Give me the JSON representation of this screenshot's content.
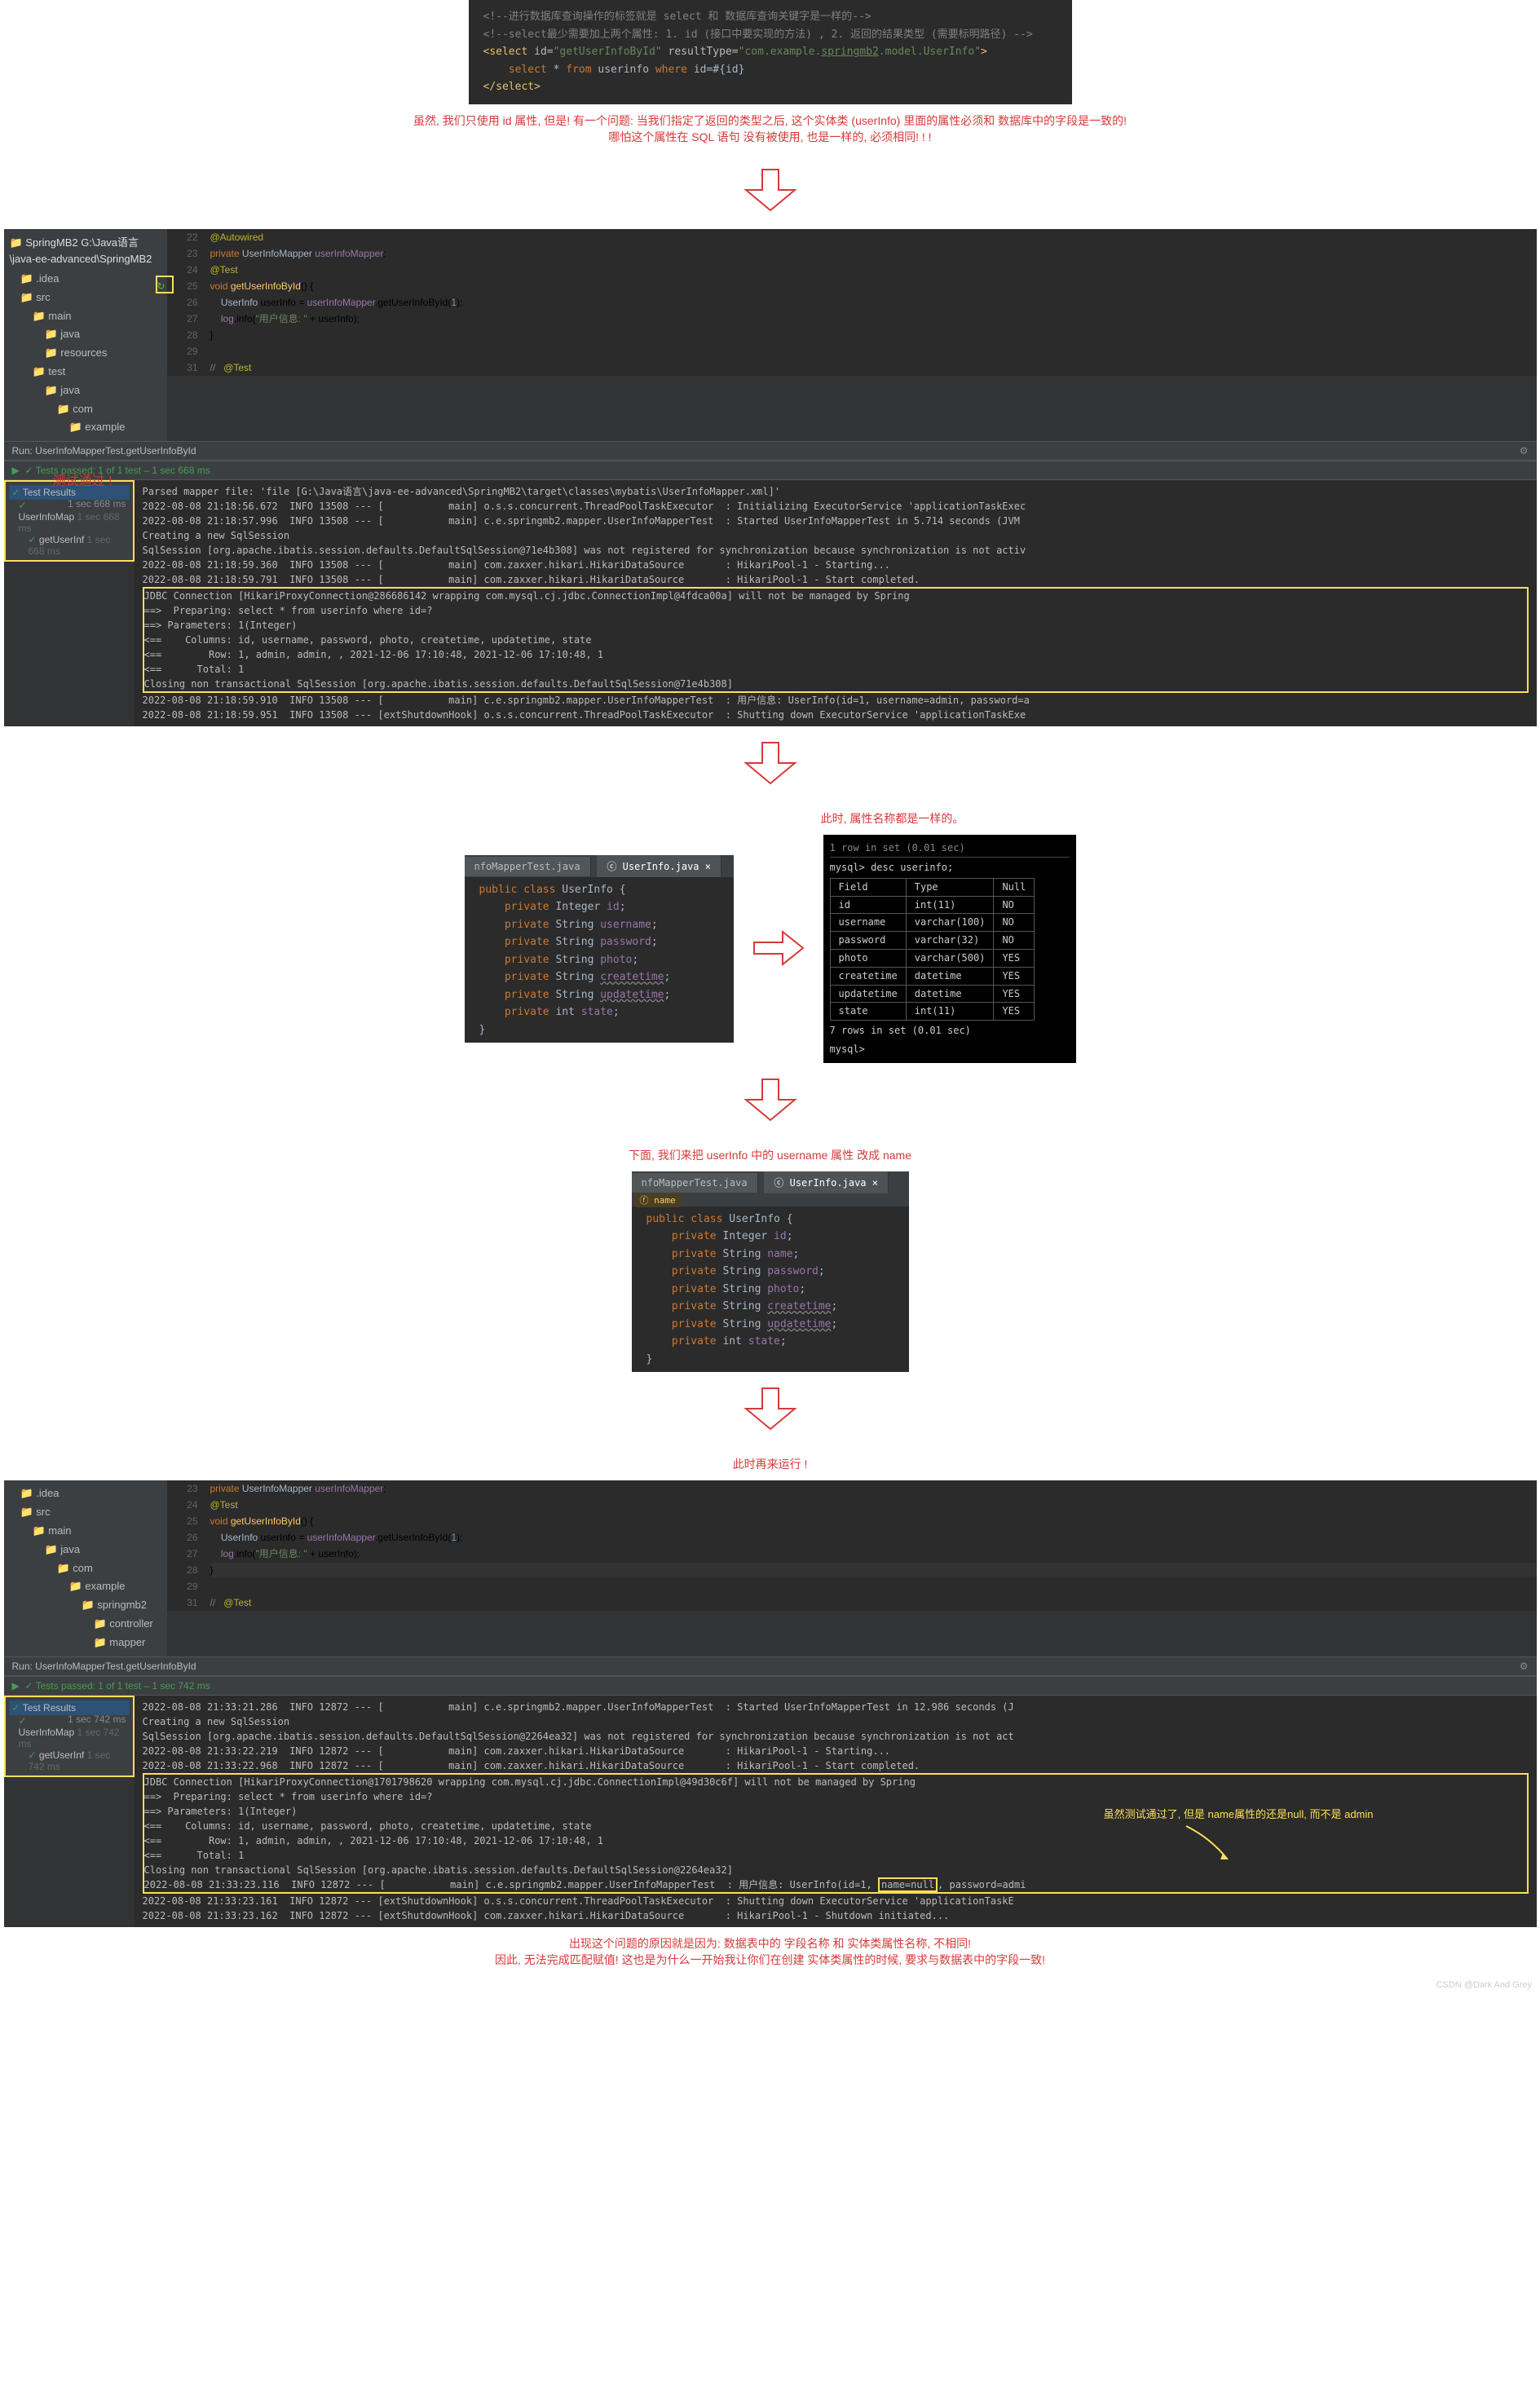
{
  "xml_snippet": {
    "comment1": "<!--进行数据库查询操作的标签就是 select 和 数据库查询关键字是一样的-->",
    "comment2": "<!--select最少需要加上两个属性: 1. id (接口中要实现的方法) , 2. 返回的结果类型 (需要标明路径) -->",
    "select_open": "<select id=\"getUserInfoById\" resultType=\"com.example.springmb2.model.UserInfo\">",
    "sql": "    select * from userinfo where id=#{id}",
    "select_close": "</select>"
  },
  "commentary1_l1": "虽然, 我们只使用 id 属性, 但是! 有一个问题: 当我们指定了返回的类型之后, 这个实体类 (userInfo) 里面的属性必须和 数据库中的字段是一致的!",
  "commentary1_l2": "哪怕这个属性在 SQL 语句 没有被使用, 也是一样的, 必须相同! ! !",
  "ide1": {
    "breadcrumb": "SpringMB2  G:\\Java语言\\java-ee-advanced\\SpringMB2",
    "tree": [
      "idea",
      "src",
      "main",
      "java",
      "resources",
      "test",
      "java",
      "com",
      "example"
    ],
    "code": {
      "l22": "@Autowired",
      "l23": "private UserInfoMapper userInfoMapper;",
      "l24": "@Test",
      "l25": "void getUserInfoById() {",
      "l26": "    UserInfo userInfo = userInfoMapper.getUserInfoById(1);",
      "l27": "    log.info(\"用户信息: \" + userInfo);",
      "l28": "}",
      "l31": "@Test"
    },
    "run_label": "Run:   UserInfoMapperTest.getUserInfoById",
    "tests_passed": "✓ Tests passed: 1 of 1 test – 1 sec 668 ms",
    "test_results": "Test Results",
    "test_time": "1 sec 668 ms",
    "test_node1": "UserInfoMap",
    "test_node2": "getUserInf",
    "red_caption": "测试通过 !"
  },
  "console1": [
    "Parsed mapper file: 'file [G:\\Java语言\\java-ee-advanced\\SpringMB2\\target\\classes\\mybatis\\UserInfoMapper.xml]'",
    "2022-08-08 21:18:56.672  INFO 13508 --- [           main] o.s.s.concurrent.ThreadPoolTaskExecutor  : Initializing ExecutorService 'applicationTaskExec",
    "2022-08-08 21:18:57.996  INFO 13508 --- [           main] c.e.springmb2.mapper.UserInfoMapperTest  : Started UserInfoMapperTest in 5.714 seconds (JVM",
    "Creating a new SqlSession",
    "SqlSession [org.apache.ibatis.session.defaults.DefaultSqlSession@71e4b308] was not registered for synchronization because synchronization is not activ",
    "2022-08-08 21:18:59.360  INFO 13508 --- [           main] com.zaxxer.hikari.HikariDataSource       : HikariPool-1 - Starting...",
    "2022-08-08 21:18:59.791  INFO 13508 --- [           main] com.zaxxer.hikari.HikariDataSource       : HikariPool-1 - Start completed.",
    "JDBC Connection [HikariProxyConnection@286686142 wrapping com.mysql.cj.jdbc.ConnectionImpl@4fdca00a] will not be managed by Spring",
    "==>  Preparing: select * from userinfo where id=?",
    "==> Parameters: 1(Integer)",
    "<==    Columns: id, username, password, photo, createtime, updatetime, state",
    "<==        Row: 1, admin, admin, , 2021-12-06 17:10:48, 2021-12-06 17:10:48, 1",
    "<==      Total: 1",
    "Closing non transactional SqlSession [org.apache.ibatis.session.defaults.DefaultSqlSession@71e4b308]",
    "2022-08-08 21:18:59.910  INFO 13508 --- [           main] c.e.springmb2.mapper.UserInfoMapperTest  : 用户信息: UserInfo(id=1, username=admin, password=a",
    "2022-08-08 21:18:59.951  INFO 13508 --- [extShutdownHook] o.s.s.concurrent.ThreadPoolTaskExecutor  : Shutting down ExecutorService 'applicationTaskExe"
  ],
  "commentary2": "此时, 属性名称都是一样的。",
  "userinfo_class": {
    "tab1": "nfoMapperTest.java",
    "tab2": "UserInfo.java",
    "lines": [
      "public class UserInfo {",
      "    private Integer id;",
      "    private String username;",
      "    private String password;",
      "    private String photo;",
      "    private String createtime;",
      "    private String updatetime;",
      "    private int state;",
      "}"
    ]
  },
  "mysql_desc": {
    "header": "mysql> desc userinfo;",
    "cols": [
      "Field",
      "Type",
      "Null"
    ],
    "rows": [
      [
        "id",
        "int(11)",
        "NO"
      ],
      [
        "username",
        "varchar(100)",
        "NO"
      ],
      [
        "password",
        "varchar(32)",
        "NO"
      ],
      [
        "photo",
        "varchar(500)",
        "YES"
      ],
      [
        "createtime",
        "datetime",
        "YES"
      ],
      [
        "updatetime",
        "datetime",
        "YES"
      ],
      [
        "state",
        "int(11)",
        "YES"
      ]
    ],
    "footer": "7 rows in set (0.01 sec)"
  },
  "commentary3": "下面, 我们来把 userInfo 中的 username 属性 改成 name",
  "userinfo_class2": {
    "tab1": "nfoMapperTest.java",
    "tab2": "UserInfo.java",
    "badge": "name",
    "lines": [
      "public class UserInfo {",
      "    private Integer id;",
      "    private String name;",
      "    private String password;",
      "    private String photo;",
      "    private String createtime;",
      "    private String updatetime;",
      "    private int state;",
      "}"
    ]
  },
  "commentary4": "此时再来运行 !",
  "ide2": {
    "tree": [
      "idea",
      "src",
      "main",
      "java",
      "com",
      "example",
      "springmb2",
      "controller",
      "mapper"
    ],
    "code": {
      "l23": "private UserInfoMapper userInfoMapper;",
      "l24": "@Test",
      "l25": "void getUserInfoById() {",
      "l26": "    UserInfo userInfo = userInfoMapper.getUserInfoById(1);",
      "l27": "    log.info(\"用户信息: \" + userInfo);",
      "l28": "}",
      "l31": "@Test"
    },
    "run_label": "Run:   UserInfoMapperTest.getUserInfoById",
    "tests_passed": "✓ Tests passed: 1 of 1 test – 1 sec 742 ms",
    "test_results": "Test Results",
    "test_time": "1 sec 742 ms"
  },
  "console2": [
    "2022-08-08 21:33:21.286  INFO 12872 --- [           main] c.e.springmb2.mapper.UserInfoMapperTest  : Started UserInfoMapperTest in 12.986 seconds (J",
    "Creating a new SqlSession",
    "SqlSession [org.apache.ibatis.session.defaults.DefaultSqlSession@2264ea32] was not registered for synchronization because synchronization is not act",
    "2022-08-08 21:33:22.219  INFO 12872 --- [           main] com.zaxxer.hikari.HikariDataSource       : HikariPool-1 - Starting...",
    "2022-08-08 21:33:22.968  INFO 12872 --- [           main] com.zaxxer.hikari.HikariDataSource       : HikariPool-1 - Start completed.",
    "JDBC Connection [HikariProxyConnection@1701798620 wrapping com.mysql.cj.jdbc.ConnectionImpl@49d30c6f] will not be managed by Spring",
    "==>  Preparing: select * from userinfo where id=?",
    "==> Parameters: 1(Integer)",
    "<==    Columns: id, username, password, photo, createtime, updatetime, state",
    "<==        Row: 1, admin, admin, , 2021-12-06 17:10:48, 2021-12-06 17:10:48, 1",
    "<==      Total: 1",
    "Closing non transactional SqlSession [org.apache.ibatis.session.defaults.DefaultSqlSession@2264ea32]",
    "2022-08-08 21:33:23.116  INFO 12872 --- [           main] c.e.springmb2.mapper.UserInfoMapperTest  : 用户信息: UserInfo(id=1, name=null, password=admi",
    "2022-08-08 21:33:23.161  INFO 12872 --- [extShutdownHook] o.s.s.concurrent.ThreadPoolTaskExecutor  : Shutting down ExecutorService 'applicationTaskE",
    "2022-08-08 21:33:23.162  INFO 12872 --- [extShutdownHook] com.zaxxer.hikari.HikariDataSource       : HikariPool-1 - Shutdown initiated..."
  ],
  "yellow_annotate": "虽然测试通过了, 但是 name属性的还是null, 而不是 admin",
  "commentary5_l1": "出现这个问题的原因就是因为: 数据表中的 字段名称 和 实体类属性名称, 不相同!",
  "commentary5_l2": "因此, 无法完成匹配赋值! 这也是为什么一开始我让你们在创建 实体类属性的时候, 要求与数据表中的字段一致!",
  "watermark": "CSDN @Dark And Grey"
}
